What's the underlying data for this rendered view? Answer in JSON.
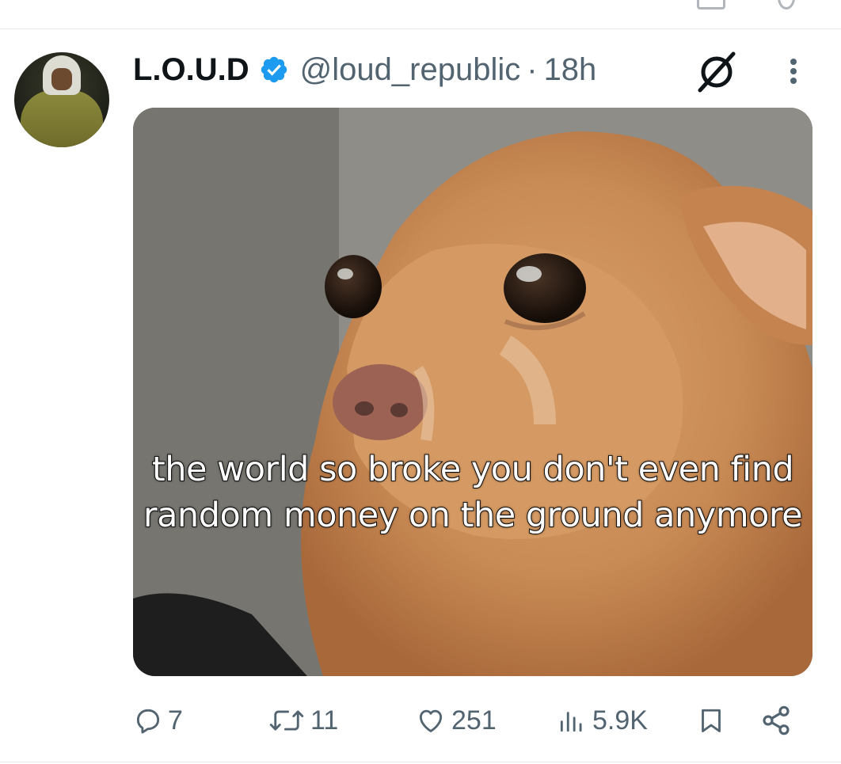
{
  "tweet": {
    "author": {
      "display_name": "L.O.U.D",
      "handle": "@loud_republic",
      "verified": true
    },
    "separator": "·",
    "time": "18h",
    "media_caption": "the world so broke you don't even find random money on the ground anymore",
    "actions": {
      "replies": "7",
      "reposts": "11",
      "likes": "251",
      "views": "5.9K"
    }
  },
  "icons": {
    "verified": "verified-badge-icon",
    "grok": "grok-icon",
    "more": "more-vertical-icon",
    "reply": "reply-icon",
    "repost": "repost-icon",
    "like": "heart-icon",
    "views": "views-icon",
    "bookmark": "bookmark-icon",
    "share": "share-icon"
  },
  "colors": {
    "accent": "#1d9bf0",
    "text_primary": "#0f1419",
    "text_secondary": "#536471",
    "divider": "#e6e9eb"
  }
}
